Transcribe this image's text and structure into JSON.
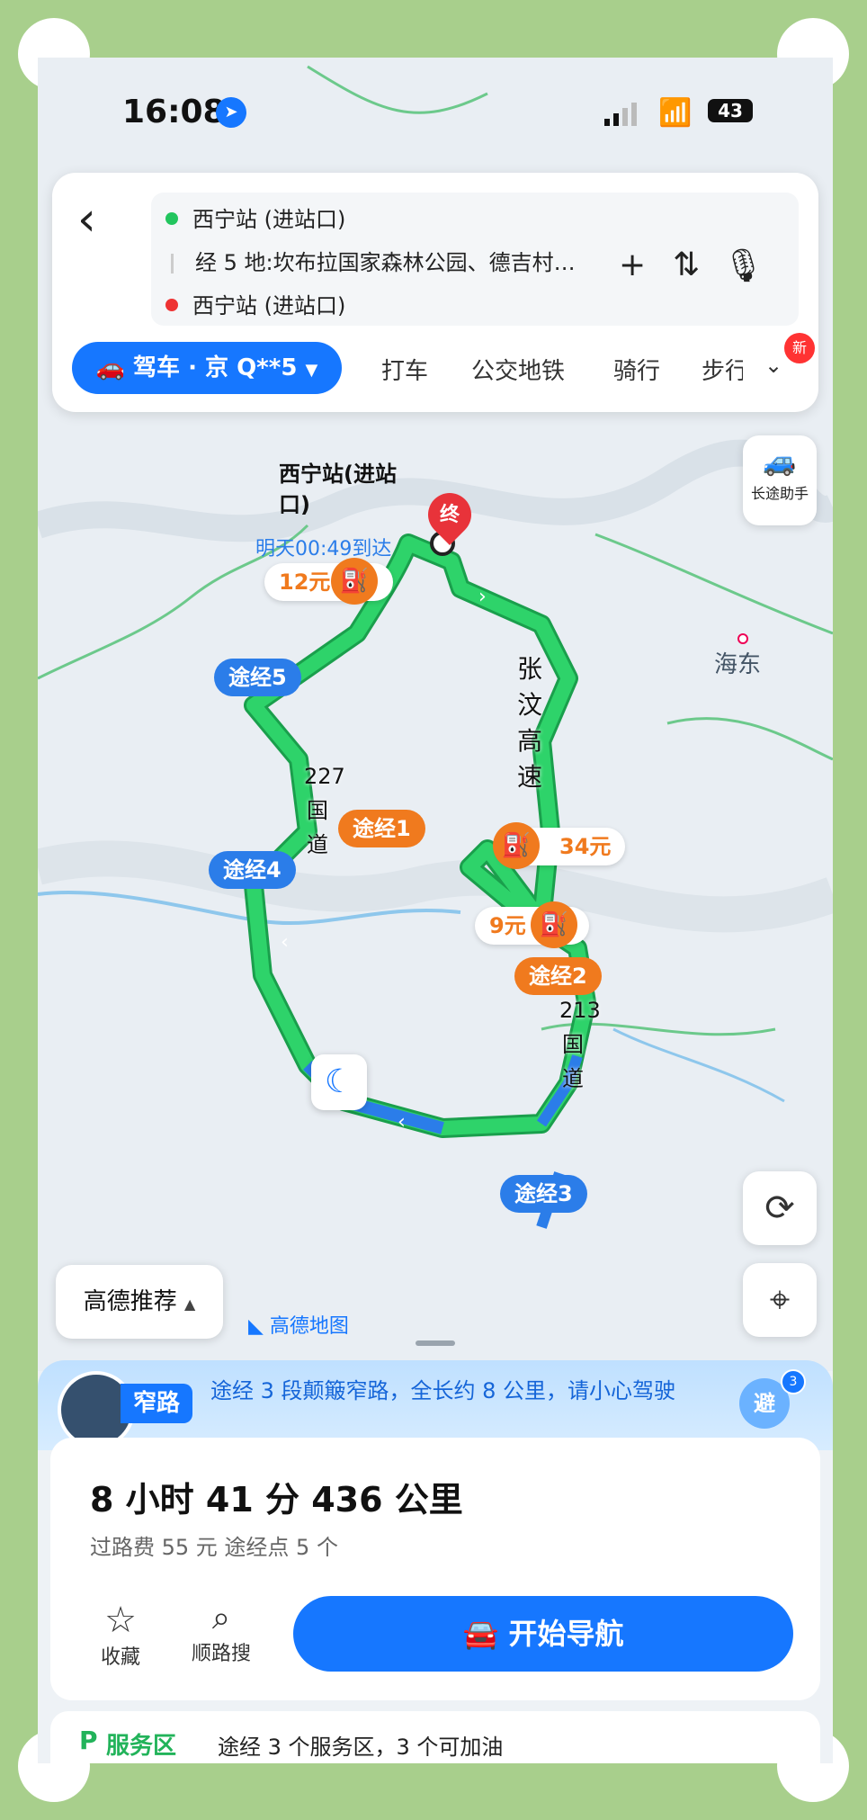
{
  "status_bar": {
    "time": "16:08",
    "battery": "43"
  },
  "route_panel": {
    "start": "西宁站 (进站口)",
    "waypoints": "经 5 地:坎布拉国家森林公园、德吉村…",
    "end": "西宁站 (进站口)"
  },
  "modes": {
    "drive": "驾车 · 京 Q**5",
    "taxi": "打车",
    "transit": "公交地铁",
    "bike": "骑行",
    "walk": "步行",
    "new_badge": "新"
  },
  "map": {
    "long_trip_helper": "长途助手",
    "destination_name": "西宁站(进站口)",
    "end_marker": "终",
    "arrival": "明天00:49到达",
    "haidong": "海东",
    "highway": "张汶高速",
    "road_227": "227国道",
    "road_213": "213国道",
    "toll_12": "12元",
    "toll_34": "34元",
    "toll_9": "9元",
    "via1": "途经1",
    "via2": "途经2",
    "via3": "途经3",
    "via4": "途经4",
    "via5": "途经5",
    "recommend": "高德推荐",
    "logo": "高德地图",
    "colors": {
      "route": "#2ed36a",
      "route_dark": "#1a9f4c",
      "blue_pin": "#2b7de9",
      "orange_pin": "#f07a1e"
    }
  },
  "narrow_notice": {
    "tag": "窄路",
    "text": "途经 3 段颠簸窄路，全长约 8 公里，请小心驾驶",
    "avoid": "避",
    "avoid_count": "3"
  },
  "summary": {
    "duration_distance": "8 小时 41 分  436 公里",
    "tolls_waypoints": "过路费 55 元   途经点 5 个",
    "favorite": "收藏",
    "search_along": "顺路搜",
    "start_nav": "开始导航"
  },
  "service_area": {
    "label": "服务区",
    "text": "途经 3 个服务区，3 个可加油"
  }
}
